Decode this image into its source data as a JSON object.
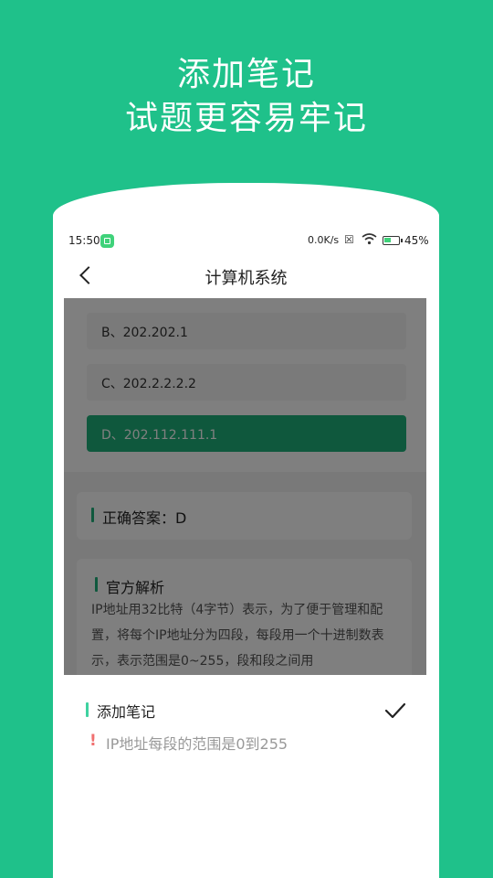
{
  "promo": {
    "line1": "添加笔记",
    "line2": "试题更容易牢记"
  },
  "status_bar": {
    "time": "15:50",
    "net_speed": "0.0K/s",
    "battery": "45%"
  },
  "nav": {
    "title": "计算机系统"
  },
  "options": [
    {
      "label": "B、202.202.1",
      "selected": false
    },
    {
      "label": "C、202.2.2.2.2",
      "selected": false
    },
    {
      "label": "D、202.112.111.1",
      "selected": true
    }
  ],
  "answer": {
    "text": "正确答案：D"
  },
  "analysis": {
    "title": "官方解析",
    "text": "IP地址用32比特（4字节）表示，为了便于管理和配置，将每个IP地址分为四段，每段用一个十进制数表示，表示范围是0~255，段和段之间用"
  },
  "note": {
    "title": "添加笔记",
    "content": "IP地址每段的范围是0到255",
    "warning_icon": "exclamation-icon",
    "confirm_icon": "check-icon"
  },
  "colors": {
    "brand_green": "#1fc18a",
    "selected_option": "#1fb07a",
    "warning_red": "#f07070"
  }
}
